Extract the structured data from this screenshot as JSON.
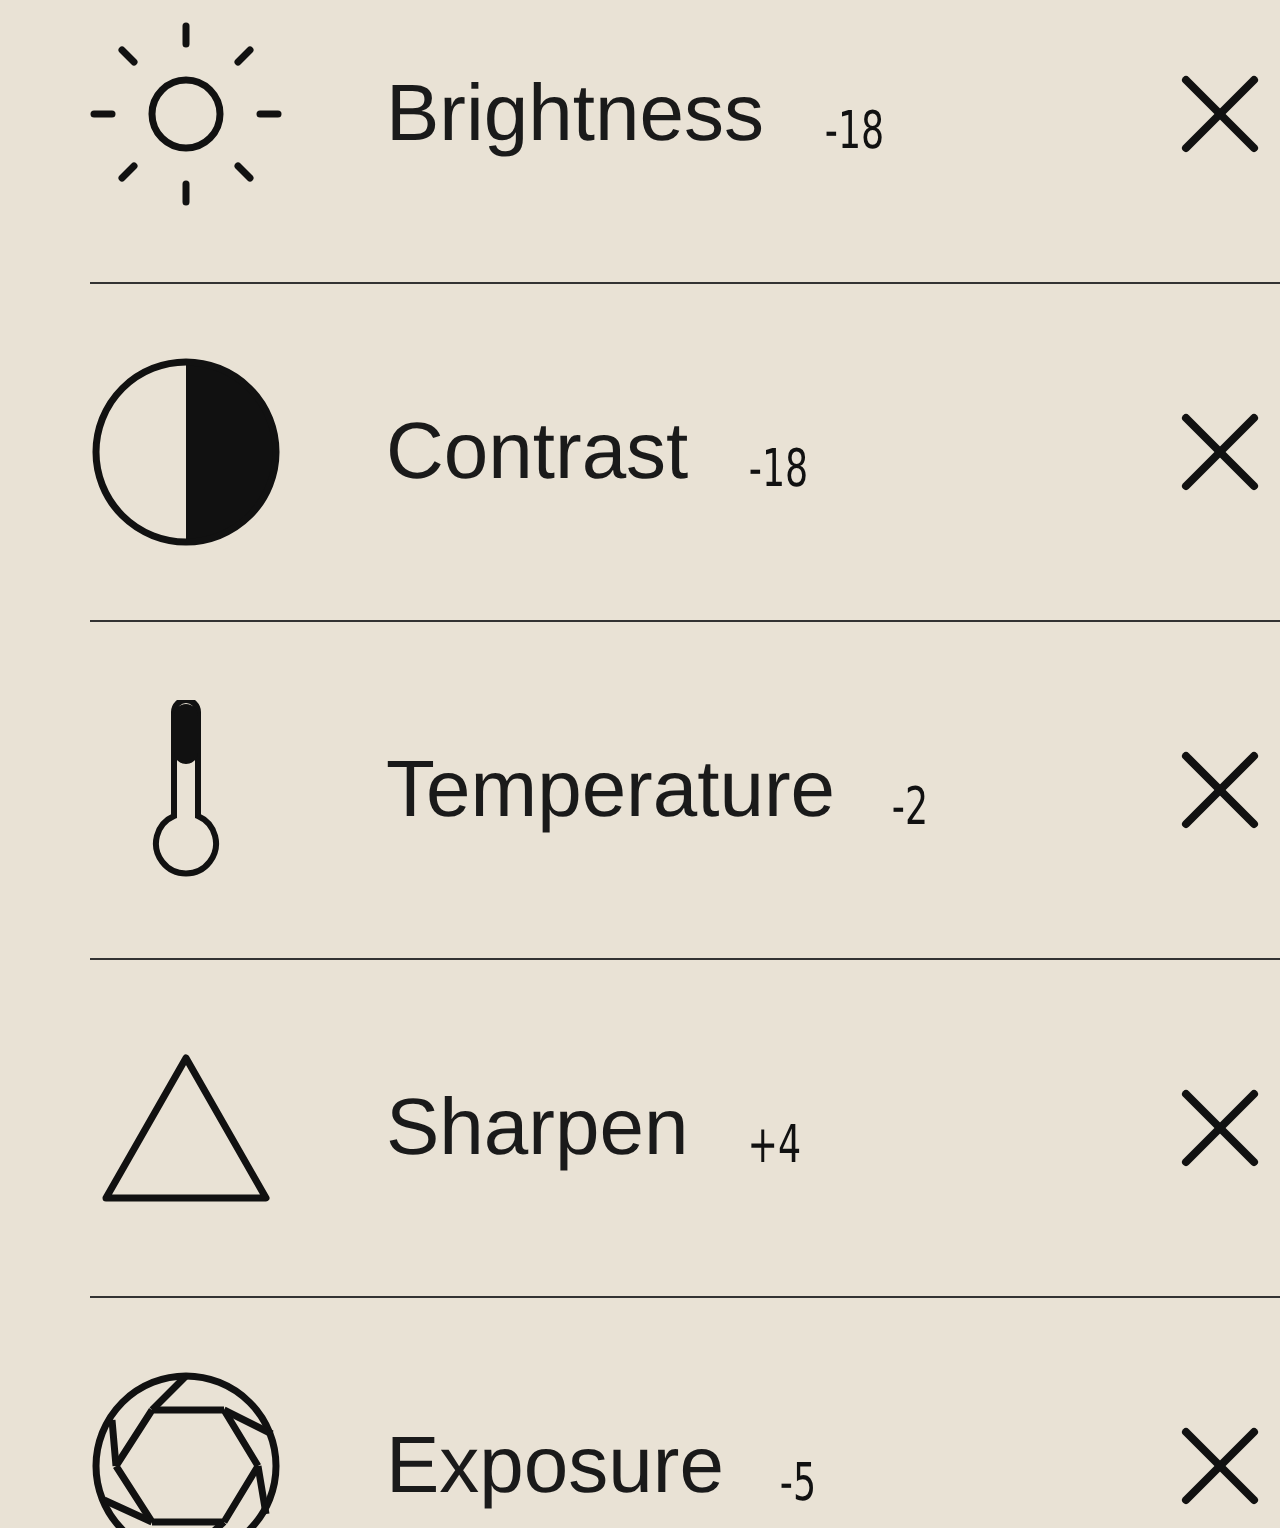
{
  "adjustments": [
    {
      "kind": "sun",
      "label": "Brightness",
      "value": "-18"
    },
    {
      "kind": "contrast",
      "label": "Contrast",
      "value": "-18"
    },
    {
      "kind": "thermometer",
      "label": "Temperature",
      "value": "-2"
    },
    {
      "kind": "triangle",
      "label": "Sharpen",
      "value": "+4"
    },
    {
      "kind": "aperture",
      "label": "Exposure",
      "value": "-5"
    }
  ]
}
